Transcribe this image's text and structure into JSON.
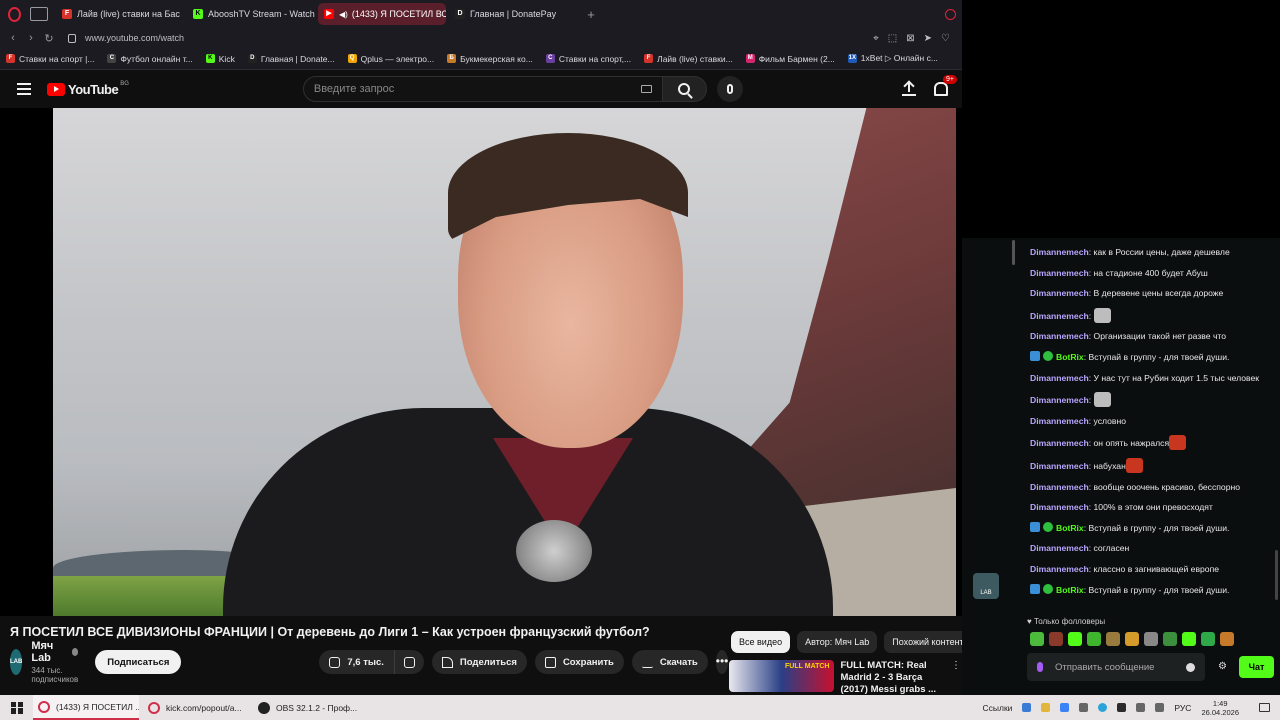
{
  "browser": {
    "tabs": [
      {
        "label": "Лайв (live) ставки на Бас",
        "fav_color": "#d6332a",
        "fav_text": "F"
      },
      {
        "label": "AbooshTV Stream - Watch",
        "fav_color": "#53fc18",
        "fav_text": "K"
      },
      {
        "label": "(1433) Я ПОСЕТИЛ ВС",
        "fav_color": "#ff0000",
        "fav_text": "▶",
        "active": true
      },
      {
        "label": "Главная | DonatePay",
        "fav_color": "#222222",
        "fav_text": "D"
      }
    ],
    "new_tab": "+",
    "url": "www.youtube.com/watch",
    "bookmarks": [
      {
        "label": "Ставки на спорт |...",
        "fav_color": "#d6332a",
        "fav_text": "F"
      },
      {
        "label": "Футбол онлайн т...",
        "fav_color": "#444444",
        "fav_text": "C"
      },
      {
        "label": "Kick",
        "fav_color": "#53fc18",
        "fav_text": "K"
      },
      {
        "label": "Главная | Donate...",
        "fav_color": "#222222",
        "fav_text": "D"
      },
      {
        "label": "Qplus — электро...",
        "fav_color": "#f0a500",
        "fav_text": "Q"
      },
      {
        "label": "Букмекерская ко...",
        "fav_color": "#c77a2a",
        "fav_text": "Б"
      },
      {
        "label": "Ставки на спорт,...",
        "fav_color": "#6b3fa0",
        "fav_text": "С"
      },
      {
        "label": "Лайв (live) ставки...",
        "fav_color": "#d6332a",
        "fav_text": "F"
      },
      {
        "label": "Фильм Бармен (2...",
        "fav_color": "#d6246e",
        "fav_text": "M"
      },
      {
        "label": "1xBet ▷ Онлайн с...",
        "fav_color": "#1e5bb8",
        "fav_text": "1X"
      }
    ]
  },
  "youtube": {
    "logo_text": "YouTube",
    "region": "BG",
    "search_placeholder": "Введите запрос",
    "notif_count": "9+",
    "video_title": "Я ПОСЕТИЛ ВСЕ ДИВИЗИОНЫ ФРАНЦИИ | От деревень до Лиги 1 – Как устроен французский футбол?",
    "channel": {
      "name": "Мяч Lab",
      "subs": "344 тыс. подписчиков",
      "avatar_text": "LAB"
    },
    "subscribe_label": "Подписаться",
    "likes": "7,6 тыс.",
    "share_label": "Поделиться",
    "save_label": "Сохранить",
    "download_label": "Скачать",
    "more_label": "•••",
    "chips": [
      "Все видео",
      "Автор: Мяч Lab",
      "Похожий контент"
    ],
    "recommended": {
      "title": "FULL MATCH: Real Madrid 2 - 3 Barça (2017) Messi grabs ...",
      "thumb_text": "FULL MATCH"
    }
  },
  "chat": {
    "messages": [
      {
        "user": "Dimannemech",
        "text": "как в России цены, даже дешевле"
      },
      {
        "user": "Dimannemech",
        "text": "на стадионе 400 будет Абуш"
      },
      {
        "user": "Dimannemech",
        "text": "В деревене цены всегда дороже"
      },
      {
        "user": "Dimannemech",
        "text": "",
        "emote": "cat"
      },
      {
        "user": "Dimannemech",
        "text": "Организации такой нет разве что"
      },
      {
        "user": "BotRix",
        "text": "Вступай в группу - для твоей души.",
        "bot": true
      },
      {
        "user": "Dimannemech",
        "text": "У нас тут на Рубин ходит 1.5 тыс человек"
      },
      {
        "user": "Dimannemech",
        "text": "",
        "emote": "cat"
      },
      {
        "user": "Dimannemech",
        "text": "условно"
      },
      {
        "user": "Dimannemech",
        "text": "он опять нажрался",
        "emote": "face"
      },
      {
        "user": "Dimannemech",
        "text": "набухан",
        "emote": "face"
      },
      {
        "user": "Dimannemech",
        "text": "вообще ооочень красиво, бесспорно"
      },
      {
        "user": "Dimannemech",
        "text": "100% в этом они превосходят"
      },
      {
        "user": "BotRix",
        "text": "Вступай в группу - для твоей души.",
        "bot": true
      },
      {
        "user": "Dimannemech",
        "text": "согласен"
      },
      {
        "user": "Dimannemech",
        "text": "классно в загнивающей европе"
      },
      {
        "user": "BotRix",
        "text": "Вступай в группу - для твоей души.",
        "bot": true
      }
    ],
    "followers_only": "♥ Только фолловеры",
    "input_placeholder": "Отправить сообщение",
    "send_label": "Чат",
    "kick_badge": "LAB"
  },
  "taskbar": {
    "tasks": [
      {
        "label": "(1433) Я ПОСЕТИЛ ...",
        "icon": "opera",
        "active": true
      },
      {
        "label": "kick.com/popout/a...",
        "icon": "opera"
      },
      {
        "label": "OBS 32.1.2 - Проф...",
        "icon": "obs"
      }
    ],
    "links_label": "Ссылки",
    "lang": "РУС",
    "time": "1:49",
    "date": "26.04.2026"
  }
}
